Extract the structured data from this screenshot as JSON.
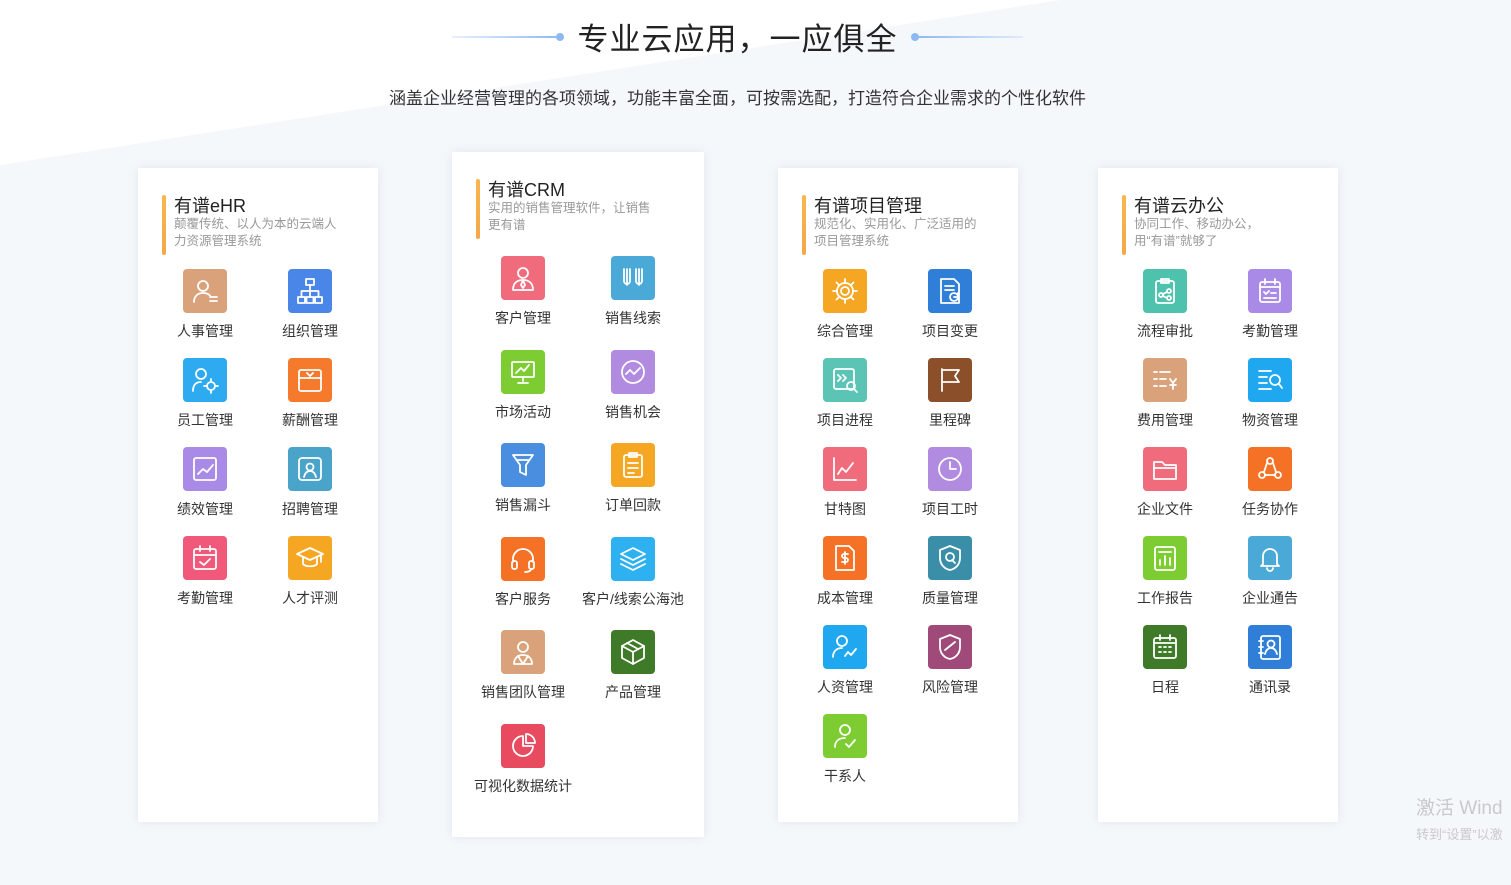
{
  "header": {
    "title": "专业云应用，一应俱全",
    "subtitle": "涵盖企业经营管理的各项领域，功能丰富全面，可按需选配，打造符合企业需求的个性化软件"
  },
  "cards": [
    {
      "title": "有谱eHR",
      "desc": [
        "颠覆传统、以人为本的云端人",
        "力资源管理系统"
      ],
      "items": [
        {
          "label": "人事管理",
          "icon": "personnel-icon",
          "color": "#d9a27a"
        },
        {
          "label": "组织管理",
          "icon": "org-chart-icon",
          "color": "#4a86e8"
        },
        {
          "label": "员工管理",
          "icon": "employee-settings-icon",
          "color": "#2eaaf0"
        },
        {
          "label": "薪酬管理",
          "icon": "salary-icon",
          "color": "#f57a2c"
        },
        {
          "label": "绩效管理",
          "icon": "performance-chart-icon",
          "color": "#a98ae6"
        },
        {
          "label": "招聘管理",
          "icon": "recruit-icon",
          "color": "#4aa3c8"
        },
        {
          "label": "考勤管理",
          "icon": "calendar-check-icon",
          "color": "#f0597a"
        },
        {
          "label": "人才评测",
          "icon": "graduation-cap-icon",
          "color": "#f5a623"
        }
      ]
    },
    {
      "title": "有谱CRM",
      "desc": [
        "实用的销售管理软件，让销售",
        "更有谱"
      ],
      "items": [
        {
          "label": "客户管理",
          "icon": "customer-icon",
          "color": "#f06c7c"
        },
        {
          "label": "销售线索",
          "icon": "sales-leads-icon",
          "color": "#4aa9d6"
        },
        {
          "label": "市场活动",
          "icon": "market-monitor-icon",
          "color": "#7ccc32"
        },
        {
          "label": "销售机会",
          "icon": "opportunity-icon",
          "color": "#b18be0"
        },
        {
          "label": "销售漏斗",
          "icon": "funnel-icon",
          "color": "#4a8ee0"
        },
        {
          "label": "订单回款",
          "icon": "order-clipboard-icon",
          "color": "#f5a623"
        },
        {
          "label": "客户服务",
          "icon": "headset-icon",
          "color": "#f57125"
        },
        {
          "label": "客户/线索公海池",
          "icon": "layers-icon",
          "color": "#2eb1f0"
        },
        {
          "label": "销售团队管理",
          "icon": "team-icon",
          "color": "#d9a27a"
        },
        {
          "label": "产品管理",
          "icon": "product-box-icon",
          "color": "#3e7a27"
        },
        {
          "label": "可视化数据统计",
          "icon": "pie-chart-icon",
          "color": "#e84a60"
        }
      ]
    },
    {
      "title": "有谱项目管理",
      "desc": [
        "规范化、实用化、广泛适用的",
        "项目管理系统"
      ],
      "items": [
        {
          "label": "综合管理",
          "icon": "gear-icon",
          "color": "#f5a623"
        },
        {
          "label": "项目变更",
          "icon": "document-refresh-icon",
          "color": "#2f7ed8"
        },
        {
          "label": "项目进程",
          "icon": "progress-search-icon",
          "color": "#5cc4b5"
        },
        {
          "label": "里程碑",
          "icon": "milestone-flag-icon",
          "color": "#8b4f2a"
        },
        {
          "label": "甘特图",
          "icon": "gantt-chart-icon",
          "color": "#f06c7c"
        },
        {
          "label": "项目工时",
          "icon": "clock-icon",
          "color": "#b18be0"
        },
        {
          "label": "成本管理",
          "icon": "cost-document-icon",
          "color": "#f57125"
        },
        {
          "label": "质量管理",
          "icon": "quality-shield-icon",
          "color": "#3a8ea8"
        },
        {
          "label": "人资管理",
          "icon": "hr-people-icon",
          "color": "#1fa8f0"
        },
        {
          "label": "风险管理",
          "icon": "risk-shield-icon",
          "color": "#a04a7a"
        },
        {
          "label": "干系人",
          "icon": "stakeholder-icon",
          "color": "#7ccc32"
        }
      ]
    },
    {
      "title": "有谱云办公",
      "desc": [
        "协同工作、移动办公，",
        "用“有谱”就够了"
      ],
      "items": [
        {
          "label": "流程审批",
          "icon": "approval-flow-icon",
          "color": "#4fc2ad"
        },
        {
          "label": "考勤管理",
          "icon": "attendance-calendar-icon",
          "color": "#a98ae6"
        },
        {
          "label": "费用管理",
          "icon": "expense-list-icon",
          "color": "#d9a27a"
        },
        {
          "label": "物资管理",
          "icon": "inventory-search-icon",
          "color": "#1fa8f0"
        },
        {
          "label": "企业文件",
          "icon": "folder-icon",
          "color": "#f06c7c"
        },
        {
          "label": "任务协作",
          "icon": "task-collab-icon",
          "color": "#f57125"
        },
        {
          "label": "工作报告",
          "icon": "report-chart-icon",
          "color": "#7ccc32"
        },
        {
          "label": "企业通告",
          "icon": "bell-icon",
          "color": "#4aa9d6"
        },
        {
          "label": "日程",
          "icon": "schedule-calendar-icon",
          "color": "#3e7a27"
        },
        {
          "label": "通讯录",
          "icon": "contacts-icon",
          "color": "#2f7ed8"
        }
      ]
    }
  ],
  "watermark": {
    "line1": "激活 Wind",
    "line2": "转到“设置”以激"
  }
}
